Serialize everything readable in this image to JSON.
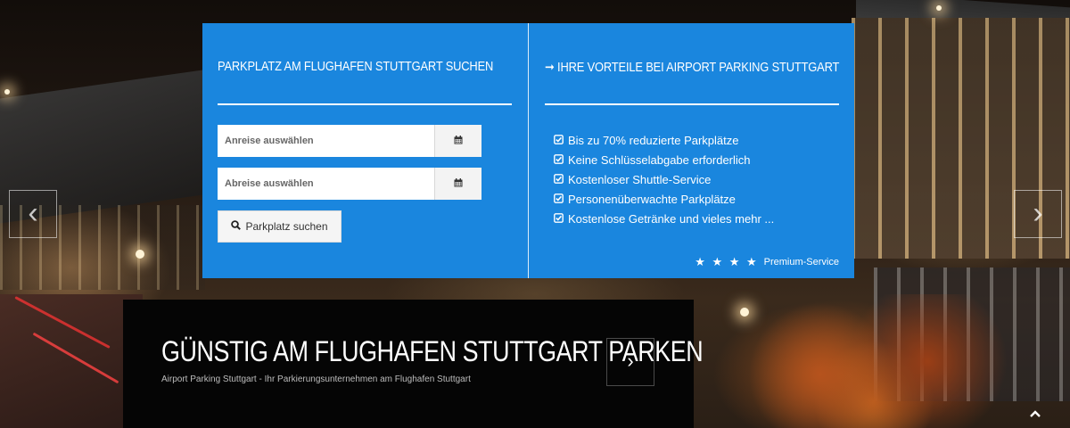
{
  "search": {
    "title": "PARKPLATZ AM FLUGHAFEN STUTTGART SUCHEN",
    "arrival_placeholder": "Anreise auswählen",
    "departure_placeholder": "Abreise auswählen",
    "button_label": "Parkplatz suchen"
  },
  "benefits": {
    "arrow": "➞",
    "title": "IHRE VORTEILE BEI AIRPORT PARKING STUTTGART",
    "items": [
      "Bis zu 70% reduzierte Parkplätze",
      "Keine Schlüsselabgabe erforderlich",
      "Kostenloser Shuttle-Service",
      "Personenüberwachte Parkplätze",
      "Kostenlose Getränke und vieles mehr ..."
    ],
    "stars": "★ ★ ★ ★",
    "premium_label": "Premium-Service"
  },
  "caption": {
    "headline": "GÜNSTIG AM FLUGHAFEN STUTTGART PARKEN",
    "subtitle": "Airport Parking Stuttgart - Ihr Parkierungsunternehmen am Flughafen Stuttgart"
  },
  "icons": {
    "calendar": "calendar-icon",
    "search": "search-icon",
    "check": "check-square-icon",
    "prev": "chevron-left-icon",
    "next": "chevron-right-icon",
    "up": "chevron-up-icon"
  },
  "colors": {
    "panel_blue": "#1a86de",
    "caption_bg": "#050505"
  }
}
